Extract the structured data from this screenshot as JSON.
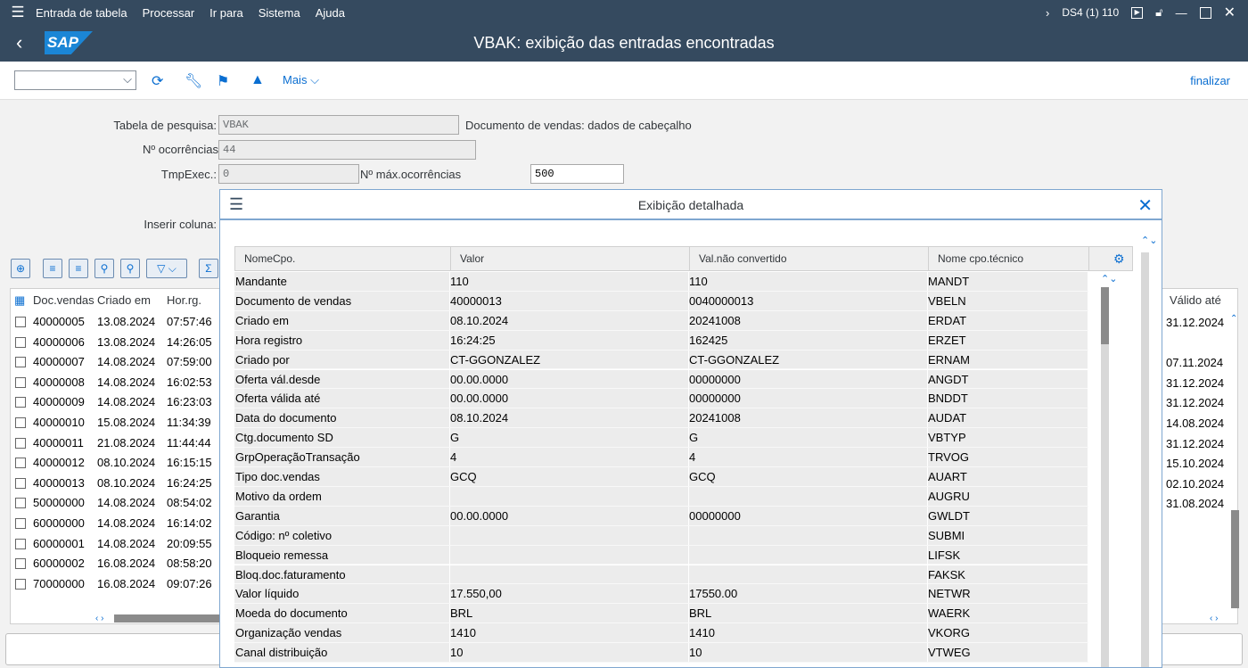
{
  "menu": {
    "items": [
      "Entrada de tabela",
      "Processar",
      "Ir para",
      "Sistema",
      "Ajuda"
    ],
    "system_id": "DS4 (1) 110"
  },
  "title": "VBAK: exibição das entradas encontradas",
  "toolbar": {
    "more_label": "Mais",
    "exit_label": "finalizar"
  },
  "form": {
    "table_label": "Tabela de pesquisa:",
    "table_value": "VBAK",
    "table_desc": "Documento de vendas: dados de cabeçalho",
    "count_label": "Nº ocorrências",
    "count_value": "44",
    "runtime_label": "TmpExec.:",
    "runtime_value": "0",
    "max_label": "Nº máx.ocorrências",
    "max_value": "500",
    "insert_col_label": "Inserir coluna:"
  },
  "bg_grid": {
    "headers": [
      "Doc.vendas",
      "Criado em",
      "Hor.rg."
    ],
    "right_header": "Válido até",
    "rows": [
      {
        "doc": "40000005",
        "date": "13.08.2024",
        "time": "07:57:46",
        "valid": "31.12.2024"
      },
      {
        "doc": "40000006",
        "date": "13.08.2024",
        "time": "14:26:05",
        "valid": ""
      },
      {
        "doc": "40000007",
        "date": "14.08.2024",
        "time": "07:59:00",
        "valid": "07.11.2024"
      },
      {
        "doc": "40000008",
        "date": "14.08.2024",
        "time": "16:02:53",
        "valid": "31.12.2024"
      },
      {
        "doc": "40000009",
        "date": "14.08.2024",
        "time": "16:23:03",
        "valid": "31.12.2024"
      },
      {
        "doc": "40000010",
        "date": "15.08.2024",
        "time": "11:34:39",
        "valid": "14.08.2024"
      },
      {
        "doc": "40000011",
        "date": "21.08.2024",
        "time": "11:44:44",
        "valid": "31.12.2024"
      },
      {
        "doc": "40000012",
        "date": "08.10.2024",
        "time": "16:15:15",
        "valid": "15.10.2024"
      },
      {
        "doc": "40000013",
        "date": "08.10.2024",
        "time": "16:24:25",
        "valid": "02.10.2024"
      },
      {
        "doc": "50000000",
        "date": "14.08.2024",
        "time": "08:54:02",
        "valid": "31.08.2024"
      },
      {
        "doc": "60000000",
        "date": "14.08.2024",
        "time": "16:14:02",
        "valid": ""
      },
      {
        "doc": "60000001",
        "date": "14.08.2024",
        "time": "20:09:55",
        "valid": ""
      },
      {
        "doc": "60000002",
        "date": "16.08.2024",
        "time": "08:58:20",
        "valid": ""
      },
      {
        "doc": "70000000",
        "date": "16.08.2024",
        "time": "09:07:26",
        "valid": ""
      }
    ]
  },
  "dialog": {
    "title": "Exibição detalhada",
    "headers": [
      "NomeCpo.",
      "Valor",
      "Val.não convertido",
      "Nome cpo.técnico"
    ],
    "rows": [
      [
        "Mandante",
        "110",
        "110",
        "MANDT"
      ],
      [
        "Documento de vendas",
        "40000013",
        "0040000013",
        "VBELN"
      ],
      [
        "Criado em",
        "08.10.2024",
        "20241008",
        "ERDAT"
      ],
      [
        "Hora registro",
        "16:24:25",
        "162425",
        "ERZET"
      ],
      [
        "Criado por",
        "CT-GGONZALEZ",
        "CT-GGONZALEZ",
        "ERNAM"
      ],
      [
        "Oferta vál.desde",
        "00.00.0000",
        "00000000",
        "ANGDT"
      ],
      [
        "Oferta válida até",
        "00.00.0000",
        "00000000",
        "BNDDT"
      ],
      [
        "Data do documento",
        "08.10.2024",
        "20241008",
        "AUDAT"
      ],
      [
        "Ctg.documento SD",
        "G",
        "G",
        "VBTYP"
      ],
      [
        "GrpOperaçãoTransação",
        "4",
        "4",
        "TRVOG"
      ],
      [
        "Tipo doc.vendas",
        "GCQ",
        "GCQ",
        "AUART"
      ],
      [
        "Motivo da ordem",
        "",
        "",
        "AUGRU"
      ],
      [
        "Garantia",
        "00.00.0000",
        "00000000",
        "GWLDT"
      ],
      [
        "Código: nº coletivo",
        "",
        "",
        "SUBMI"
      ],
      [
        "Bloqueio remessa",
        "",
        "",
        "LIFSK"
      ],
      [
        "Bloq.doc.faturamento",
        "",
        "",
        "FAKSK"
      ],
      [
        "Valor líquido",
        "17.550,00",
        "17550.00",
        "NETWR"
      ],
      [
        "Moeda do documento",
        "BRL",
        "BRL",
        "WAERK"
      ],
      [
        "Organização vendas",
        "1410",
        "1410",
        "VKORG"
      ],
      [
        "Canal distribuição",
        "10",
        "10",
        "VTWEG"
      ]
    ]
  }
}
